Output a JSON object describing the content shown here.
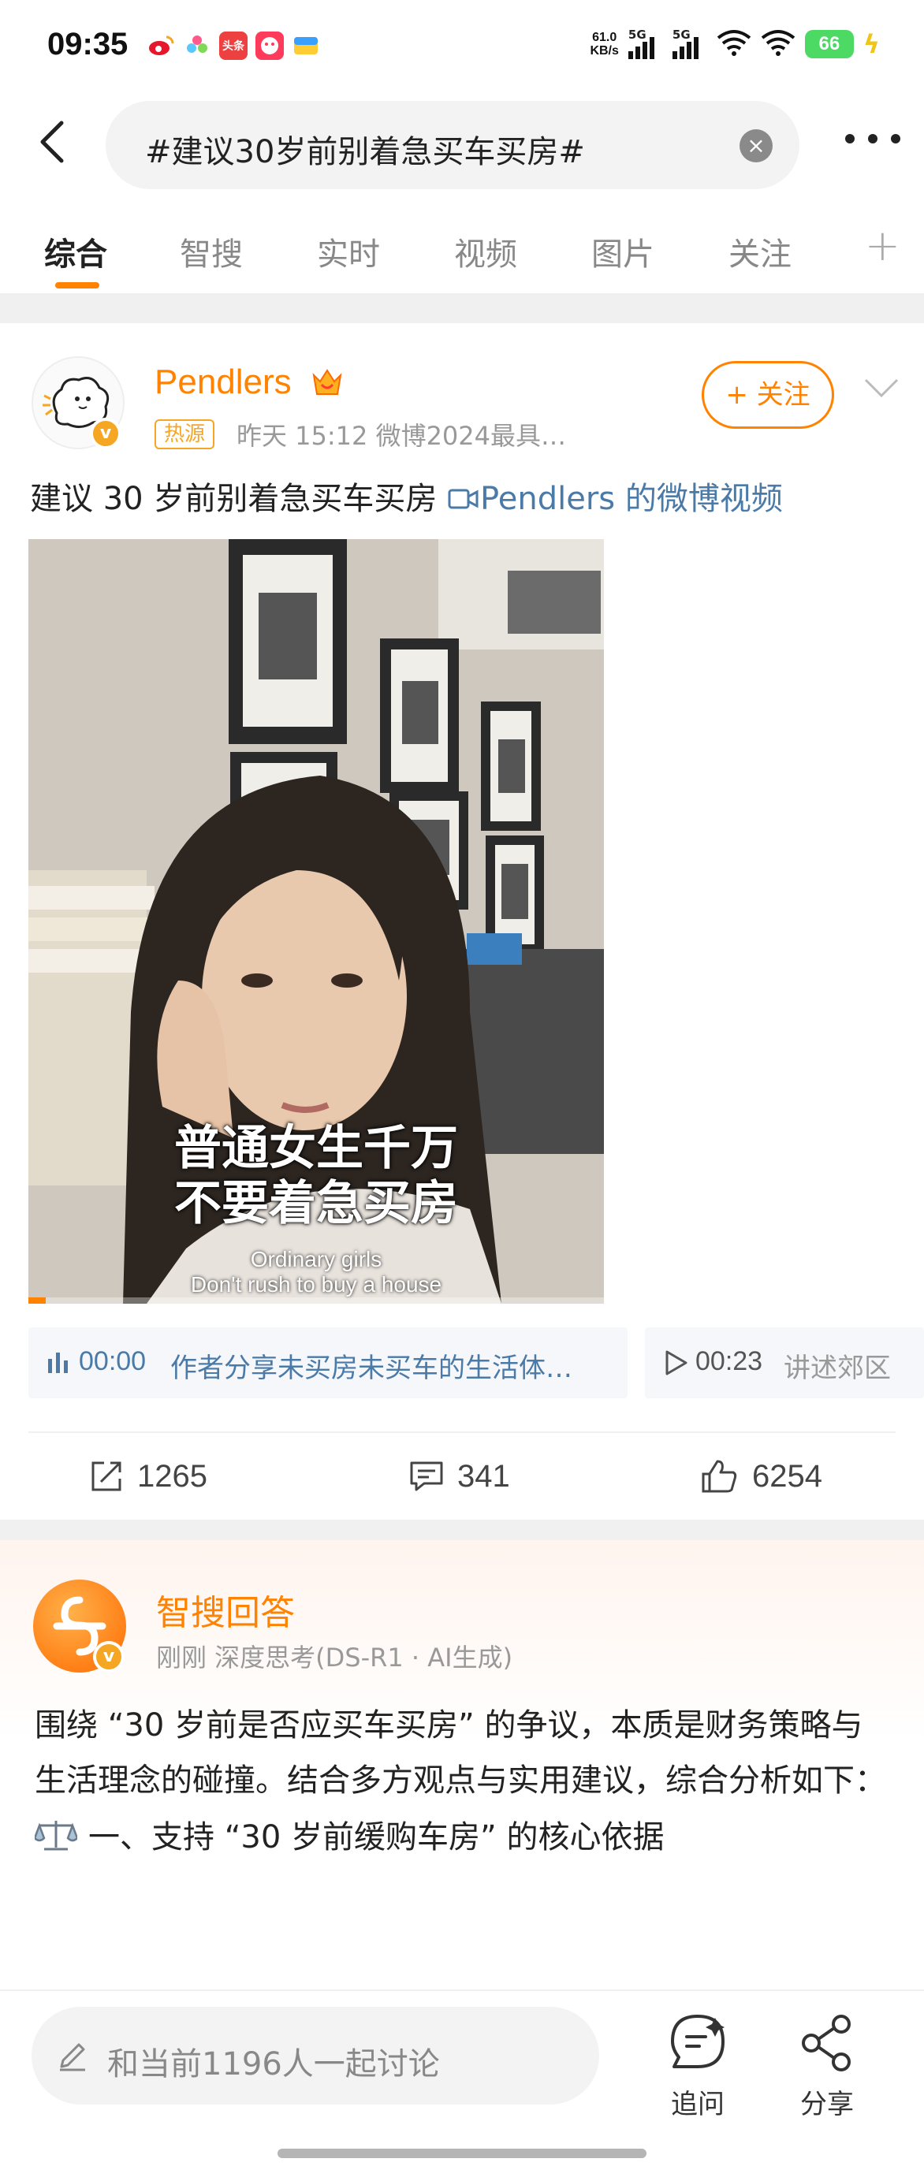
{
  "status_bar": {
    "time": "09:35",
    "net_speed_value": "61.0",
    "net_speed_unit": "KB/s",
    "signal1": "5G",
    "signal2": "5G",
    "battery": "66",
    "app_icons": [
      "weibo-icon",
      "flower-app-icon",
      "toutiao-icon",
      "red-app-icon",
      "mail-app-icon"
    ]
  },
  "search": {
    "query": "#建议30岁前别着急买车买房#"
  },
  "tabs": [
    "综合",
    "智搜",
    "实时",
    "视频",
    "图片",
    "关注"
  ],
  "active_tab": "综合",
  "post": {
    "author": "Pendlers",
    "hot_tag": "热源",
    "meta": "昨天 15:12   微博2024最具…",
    "follow_label": "+ 关注",
    "text": "建议 30 岁前别着急买车买房 ",
    "video_link": "Pendlers 的微博视频",
    "video": {
      "subtitle_cn_line1": "普通女生千万",
      "subtitle_cn_line2": "不要着急买房",
      "subtitle_en_line1": "Ordinary girls",
      "subtitle_en_line2": "Don't rush to buy a house",
      "progress": 0.03
    },
    "chapters": [
      {
        "time": "00:00",
        "desc": "作者分享未买房未买车的生活体…"
      },
      {
        "time": "00:23",
        "desc": "讲述郊区"
      }
    ],
    "actions": {
      "repost": "1265",
      "comments": "341",
      "likes": "6254"
    }
  },
  "smart_answer": {
    "title": "智搜回答",
    "meta": "刚刚  深度思考(DS-R1 · AI生成)",
    "body": "围绕 “30 岁前是否应买车买房” 的争议，本质是财务策略与生活理念的碰撞。结合多方观点与实用建议，综合分析如下：",
    "heading": "一、支持 “30 岁前缓购车房” 的核心依据"
  },
  "bottom_bar": {
    "input_placeholder": "和当前1196人一起讨论",
    "ask_label": "追问",
    "share_label": "分享"
  },
  "colors": {
    "accent": "#ff8200",
    "link": "#4a7aa8"
  }
}
